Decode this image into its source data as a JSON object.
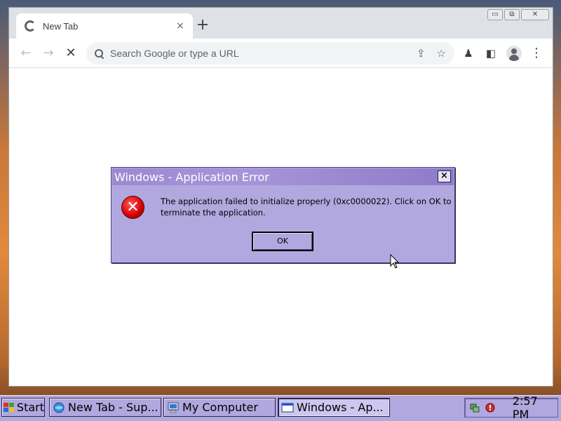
{
  "browser": {
    "tab": {
      "title": "New Tab",
      "favicon": "chrome-loading-icon",
      "close": "×"
    },
    "new_tab": "+",
    "window_controls": {
      "minimize": "▭",
      "restore": "⧉",
      "close": "✕"
    },
    "toolbar": {
      "back": "←",
      "forward": "→",
      "stop": "✕",
      "omnibox_placeholder": "Search Google or type a URL",
      "share": "⇪",
      "bookmark": "☆",
      "extensions": "♟",
      "side_panel": "◧",
      "menu": "⋮"
    }
  },
  "dialog": {
    "title": "Windows - Application Error",
    "close": "×",
    "message": "The application failed to initialize properly (0xc0000022). Click on OK to terminate the application.",
    "ok_label": "OK",
    "icon": "error-icon"
  },
  "taskbar": {
    "start_label": "Start",
    "tasks": [
      {
        "label": "New Tab - Sup...",
        "icon": "browser-icon",
        "active": false
      },
      {
        "label": "My Computer",
        "icon": "my-computer-icon",
        "active": false
      },
      {
        "label": "Windows - Ap...",
        "icon": "window-icon",
        "active": true
      }
    ],
    "clock": "2:57 PM"
  },
  "colors": {
    "dialog_bg": "#b1a8df",
    "taskbar_bg": "#b1a8df",
    "error_red": "#d40000"
  }
}
